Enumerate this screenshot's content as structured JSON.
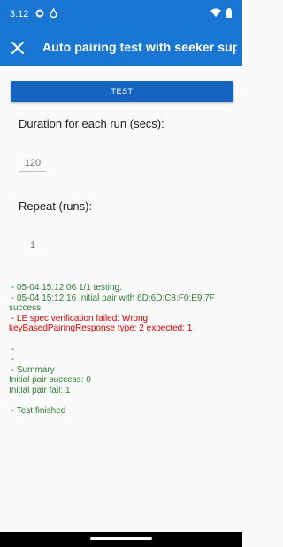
{
  "status_bar": {
    "time": "3:12",
    "colors": {
      "background": "#1976d2"
    },
    "left_icons": [
      "settings-gear-icon",
      "data-saver-icon"
    ],
    "right_icons": [
      "wifi-icon",
      "battery-icon"
    ]
  },
  "app_bar": {
    "title": "Auto pairing test with seeker sup...",
    "close_icon": "close-icon"
  },
  "test_button": {
    "label": "TEST"
  },
  "duration": {
    "label": "Duration for each run (secs):",
    "placeholder": "120"
  },
  "repeat": {
    "label": "Repeat (runs):",
    "placeholder": "1"
  },
  "log": {
    "colors": {
      "success": "#2e7d32",
      "error": "#d50000"
    },
    "lines": [
      {
        "text": " - 05-04 15:12:06 1/1 testing.",
        "status": "success"
      },
      {
        "text": " - 05-04 15:12:16 Initial pair with 6D:6D:C8:F0:E9:7F success.",
        "status": "success"
      },
      {
        "text": " - LE spec verification failed: Wrong keyBasedPairingResponse type: 2 expected: 1",
        "status": "error"
      },
      {
        "text": "",
        "status": "blank"
      },
      {
        "text": " -",
        "status": "success"
      },
      {
        "text": " -",
        "status": "success"
      },
      {
        "text": " - Summary",
        "status": "success"
      },
      {
        "text": "Initial pair success: 0",
        "status": "success"
      },
      {
        "text": "Initial pair fail: 1",
        "status": "success"
      },
      {
        "text": "",
        "status": "blank"
      },
      {
        "text": " - Test finished",
        "status": "success"
      }
    ]
  }
}
